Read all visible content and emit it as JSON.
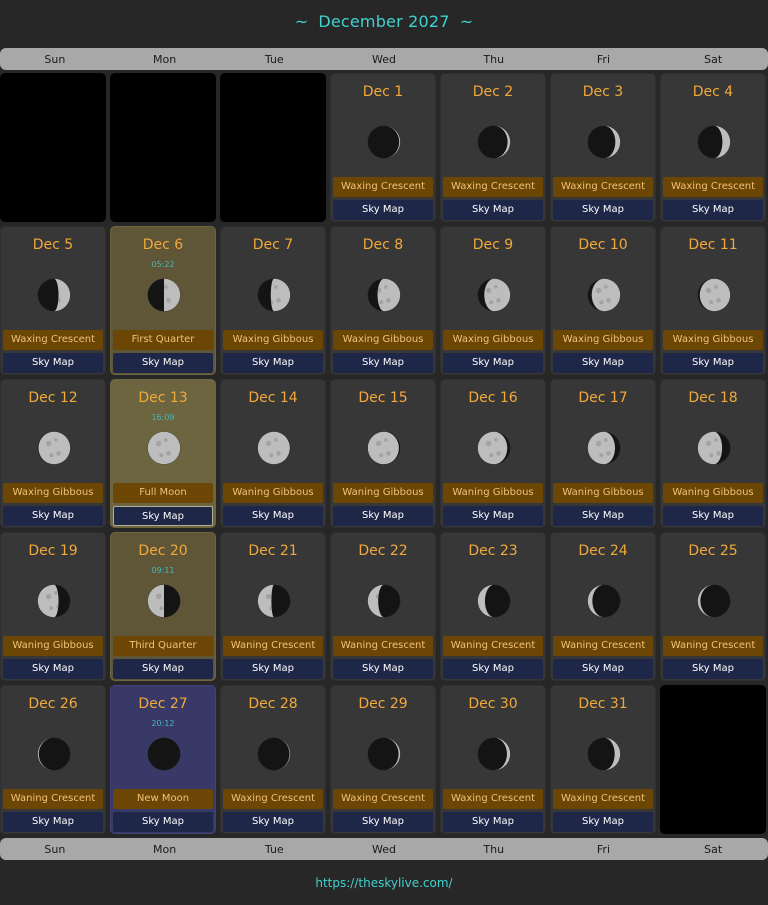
{
  "header": {
    "tilde_left": "~",
    "title": "December 2027",
    "tilde_right": "~"
  },
  "weekdays": [
    "Sun",
    "Mon",
    "Tue",
    "Wed",
    "Thu",
    "Fri",
    "Sat"
  ],
  "labels": {
    "sky_map": "Sky Map"
  },
  "cells": [
    {
      "empty": true
    },
    {
      "empty": true
    },
    {
      "empty": true
    },
    {
      "date": "Dec 1",
      "phase": "Waxing Crescent",
      "illum": 0.03,
      "waxing": true
    },
    {
      "date": "Dec 2",
      "phase": "Waxing Crescent",
      "illum": 0.08,
      "waxing": true
    },
    {
      "date": "Dec 3",
      "phase": "Waxing Crescent",
      "illum": 0.15,
      "waxing": true
    },
    {
      "date": "Dec 4",
      "phase": "Waxing Crescent",
      "illum": 0.24,
      "waxing": true
    },
    {
      "date": "Dec 5",
      "phase": "Waxing Crescent",
      "illum": 0.36,
      "waxing": true
    },
    {
      "date": "Dec 6",
      "time": "05:22",
      "phase": "First Quarter",
      "illum": 0.5,
      "waxing": true,
      "highlight": "first-quarter"
    },
    {
      "date": "Dec 7",
      "phase": "Waxing Gibbous",
      "illum": 0.6,
      "waxing": true
    },
    {
      "date": "Dec 8",
      "phase": "Waxing Gibbous",
      "illum": 0.7,
      "waxing": true
    },
    {
      "date": "Dec 9",
      "phase": "Waxing Gibbous",
      "illum": 0.8,
      "waxing": true
    },
    {
      "date": "Dec 10",
      "phase": "Waxing Gibbous",
      "illum": 0.88,
      "waxing": true
    },
    {
      "date": "Dec 11",
      "phase": "Waxing Gibbous",
      "illum": 0.94,
      "waxing": true
    },
    {
      "date": "Dec 12",
      "phase": "Waxing Gibbous",
      "illum": 0.98,
      "waxing": true
    },
    {
      "date": "Dec 13",
      "time": "16:09",
      "phase": "Full Moon",
      "illum": 1.0,
      "waxing": true,
      "highlight": "full-moon"
    },
    {
      "date": "Dec 14",
      "phase": "Waning Gibbous",
      "illum": 0.99,
      "waxing": false
    },
    {
      "date": "Dec 15",
      "phase": "Waning Gibbous",
      "illum": 0.96,
      "waxing": false
    },
    {
      "date": "Dec 16",
      "phase": "Waning Gibbous",
      "illum": 0.91,
      "waxing": false
    },
    {
      "date": "Dec 17",
      "phase": "Waning Gibbous",
      "illum": 0.84,
      "waxing": false
    },
    {
      "date": "Dec 18",
      "phase": "Waning Gibbous",
      "illum": 0.75,
      "waxing": false
    },
    {
      "date": "Dec 19",
      "phase": "Waning Gibbous",
      "illum": 0.64,
      "waxing": false
    },
    {
      "date": "Dec 20",
      "time": "09:11",
      "phase": "Third Quarter",
      "illum": 0.5,
      "waxing": false,
      "highlight": "third-quarter"
    },
    {
      "date": "Dec 21",
      "phase": "Waning Crescent",
      "illum": 0.42,
      "waxing": false
    },
    {
      "date": "Dec 22",
      "phase": "Waning Crescent",
      "illum": 0.32,
      "waxing": false
    },
    {
      "date": "Dec 23",
      "phase": "Waning Crescent",
      "illum": 0.22,
      "waxing": false
    },
    {
      "date": "Dec 24",
      "phase": "Waning Crescent",
      "illum": 0.14,
      "waxing": false
    },
    {
      "date": "Dec 25",
      "phase": "Waning Crescent",
      "illum": 0.08,
      "waxing": false
    },
    {
      "date": "Dec 26",
      "phase": "Waning Crescent",
      "illum": 0.03,
      "waxing": false
    },
    {
      "date": "Dec 27",
      "time": "20:12",
      "phase": "New Moon",
      "illum": 0.0,
      "waxing": false,
      "highlight": "new-moon"
    },
    {
      "date": "Dec 28",
      "phase": "Waxing Crescent",
      "illum": 0.02,
      "waxing": true
    },
    {
      "date": "Dec 29",
      "phase": "Waxing Crescent",
      "illum": 0.05,
      "waxing": true
    },
    {
      "date": "Dec 30",
      "phase": "Waxing Crescent",
      "illum": 0.1,
      "waxing": true
    },
    {
      "date": "Dec 31",
      "phase": "Waxing Crescent",
      "illum": 0.17,
      "waxing": true
    },
    {
      "empty": true
    }
  ],
  "footer": {
    "link": "https://theskylive.com/"
  },
  "colors": {
    "date": "#f2a93b",
    "title": "#3fd3d0",
    "phase_bg": "#6b4605",
    "skymap_bg": "#1f2748",
    "quarter_bg": "#5e5636",
    "new_moon_bg": "#393968"
  },
  "icons": {
    "moon": "moon-phase-icon"
  }
}
